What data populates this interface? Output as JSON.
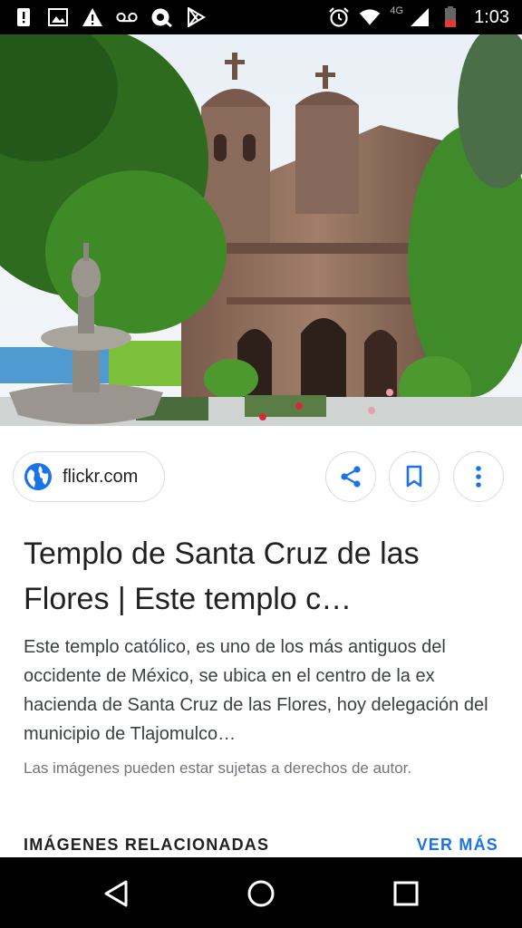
{
  "status_bar": {
    "time": "1:03",
    "network": "4G",
    "left_icons": [
      "alert-icon",
      "image-icon",
      "warning-icon",
      "voicemail-icon",
      "location-icon",
      "play-store-icon"
    ],
    "right_icons": [
      "alarm-icon",
      "wifi-icon",
      "signal-icon",
      "battery-icon"
    ]
  },
  "image": {
    "description_icon": "church-photo"
  },
  "source": {
    "label": "flickr.com",
    "icon": "globe-icon"
  },
  "actions": {
    "share_icon": "share-icon",
    "save_icon": "bookmark-icon",
    "more_icon": "more-vert-icon"
  },
  "result": {
    "title": "Templo de Santa Cruz de las Flores | Este templo c…",
    "description": "Este templo católico, es uno de los más antiguos del occidente de México, se ubica en el centro de la ex hacienda de Santa Cruz de las Flores, hoy delegación del municipio de Tlajomulco…",
    "copyright": "Las imágenes pueden estar sujetas a derechos de autor."
  },
  "related": {
    "heading": "IMÁGENES RELACIONADAS",
    "more_label": "VER MÁS"
  },
  "colors": {
    "accent": "#1a73e8",
    "text": "#202124",
    "muted": "#70757a"
  },
  "nav_bar": {
    "buttons": [
      "back-icon",
      "home-icon",
      "recents-icon"
    ]
  }
}
